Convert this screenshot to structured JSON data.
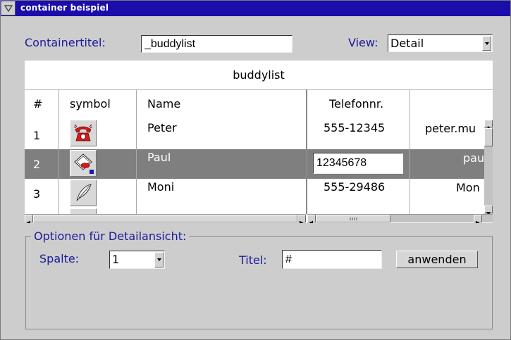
{
  "window": {
    "title": "container beispiel"
  },
  "form": {
    "containertitel_label": "Containertitel:",
    "containertitel_value": "_buddylist",
    "view_label": "View:",
    "view_value": "Detail"
  },
  "table": {
    "caption": "buddylist",
    "columns": [
      "#",
      "symbol",
      "Name",
      "Telefonnr."
    ],
    "rows": [
      {
        "num": "1",
        "symbol": "telephone-icon",
        "name": "Peter",
        "phone": "555-12345",
        "extra": "peter.mu"
      },
      {
        "num": "2",
        "symbol": "fax-icon",
        "name": "Paul",
        "phone": "12345678",
        "extra": "pau",
        "selected": true
      },
      {
        "num": "3",
        "symbol": "quill-icon",
        "name": "Moni",
        "phone": "555-29486",
        "extra": "Mon"
      }
    ]
  },
  "options": {
    "group_title": "Optionen für Detailansicht:",
    "spalte_label": "Spalte:",
    "spalte_value": "1",
    "titel_label": "Titel:",
    "titel_value": "#",
    "apply_label": "anwenden"
  },
  "colors": {
    "titlebar": "#1a0dab",
    "label": "#1a1a9a",
    "selection": "#7f7f7f"
  }
}
